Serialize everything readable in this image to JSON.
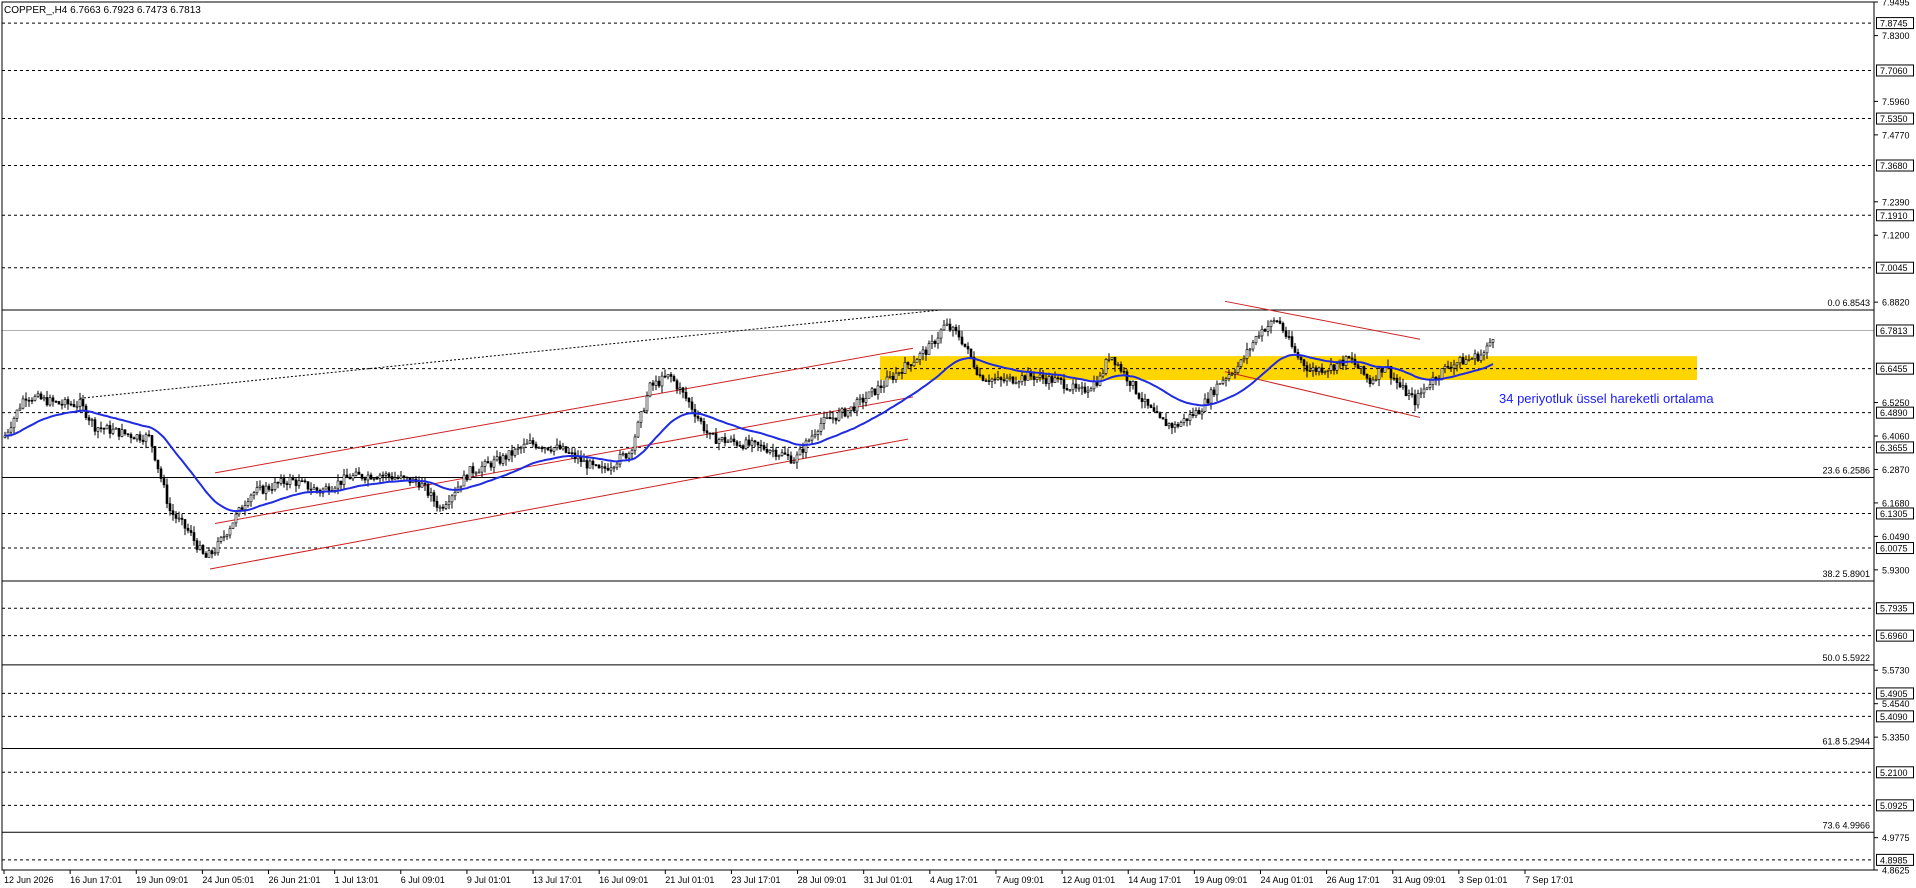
{
  "header": {
    "symbol_info": "COPPER_,H4  6.7663 6.7923 6.7473 6.7813"
  },
  "chart_data": {
    "type": "candlestick",
    "symbol": "COPPER_",
    "timeframe": "H4",
    "ohlc_header": {
      "open": 6.7663,
      "high": 6.7923,
      "low": 6.7473,
      "close": 6.7813
    },
    "ylim": [
      4.8625,
      7.9495
    ],
    "y_ticks": [
      "7.9495",
      "7.8300",
      "7.5960",
      "7.4770",
      "7.2390",
      "7.1200",
      "6.8820",
      "6.5250",
      "6.4060",
      "6.2870",
      "6.1680",
      "6.0490",
      "5.9300",
      "5.5730",
      "5.4540",
      "5.3350",
      "4.9775",
      "4.8625"
    ],
    "x_labels": [
      "12 Jun 2026",
      "16 Jun 17:01",
      "19 Jun 09:01",
      "24 Jun 05:01",
      "26 Jun 21:01",
      "1 Jul 13:01",
      "6 Jul 09:01",
      "9 Jul 01:01",
      "13 Jul 17:01",
      "16 Jul 09:01",
      "21 Jul 01:01",
      "23 Jul 17:01",
      "28 Jul 09:01",
      "31 Jul 01:01",
      "4 Aug 17:01",
      "7 Aug 09:01",
      "12 Aug 01:01",
      "14 Aug 17:01",
      "19 Aug 09:01",
      "24 Aug 01:01",
      "26 Aug 17:01",
      "31 Aug 09:01",
      "3 Sep 01:01",
      "7 Sep 17:01"
    ],
    "horizontal_levels": [
      {
        "value": 7.8745,
        "label": "7.8745",
        "style": "dashed"
      },
      {
        "value": 7.706,
        "label": "7.7060",
        "style": "dashed"
      },
      {
        "value": 7.535,
        "label": "7.5350",
        "style": "dashed"
      },
      {
        "value": 7.368,
        "label": "7.3680",
        "style": "dashed"
      },
      {
        "value": 7.191,
        "label": "7.1910",
        "style": "dashed"
      },
      {
        "value": 7.0045,
        "label": "7.0045",
        "style": "dashed"
      },
      {
        "value": 6.6455,
        "label": "6.6455",
        "style": "dashed"
      },
      {
        "value": 6.489,
        "label": "6.4890",
        "style": "dashed"
      },
      {
        "value": 6.3655,
        "label": "6.3655",
        "style": "dashed"
      },
      {
        "value": 6.1305,
        "label": "6.1305",
        "style": "dashed"
      },
      {
        "value": 6.0075,
        "label": "6.0075",
        "style": "dashed"
      },
      {
        "value": 5.7935,
        "label": "5.7935",
        "style": "dashed"
      },
      {
        "value": 5.696,
        "label": "5.6960",
        "style": "dashed"
      },
      {
        "value": 5.4905,
        "label": "5.4905",
        "style": "dashed"
      },
      {
        "value": 5.409,
        "label": "5.4090",
        "style": "dashed"
      },
      {
        "value": 5.21,
        "label": "5.2100",
        "style": "dashed"
      },
      {
        "value": 5.0925,
        "label": "5.0925",
        "style": "dashed"
      },
      {
        "value": 4.8985,
        "label": "4.8985",
        "style": "dashed"
      }
    ],
    "current_price": {
      "value": 6.7813,
      "label": "6.7813"
    },
    "fibonacci": [
      {
        "value": 6.8543,
        "label": "0.0 6.8543"
      },
      {
        "value": 6.2586,
        "label": "23.6 6.2586"
      },
      {
        "value": 5.8901,
        "label": "38.2 5.8901"
      },
      {
        "value": 5.5922,
        "label": "50.0 5.5922"
      },
      {
        "value": 5.2944,
        "label": "61.8 5.2944"
      },
      {
        "value": 4.9966,
        "label": "73.6 4.9966"
      }
    ],
    "annotation": "34 periyotluk üssel hareketli ortalama",
    "colors": {
      "candle": "#000000",
      "ema": "#1f2be0",
      "channel": "#cc2222",
      "zone": "#ffd500",
      "annotation": "#1a1aff",
      "level_line": "#000000"
    }
  }
}
